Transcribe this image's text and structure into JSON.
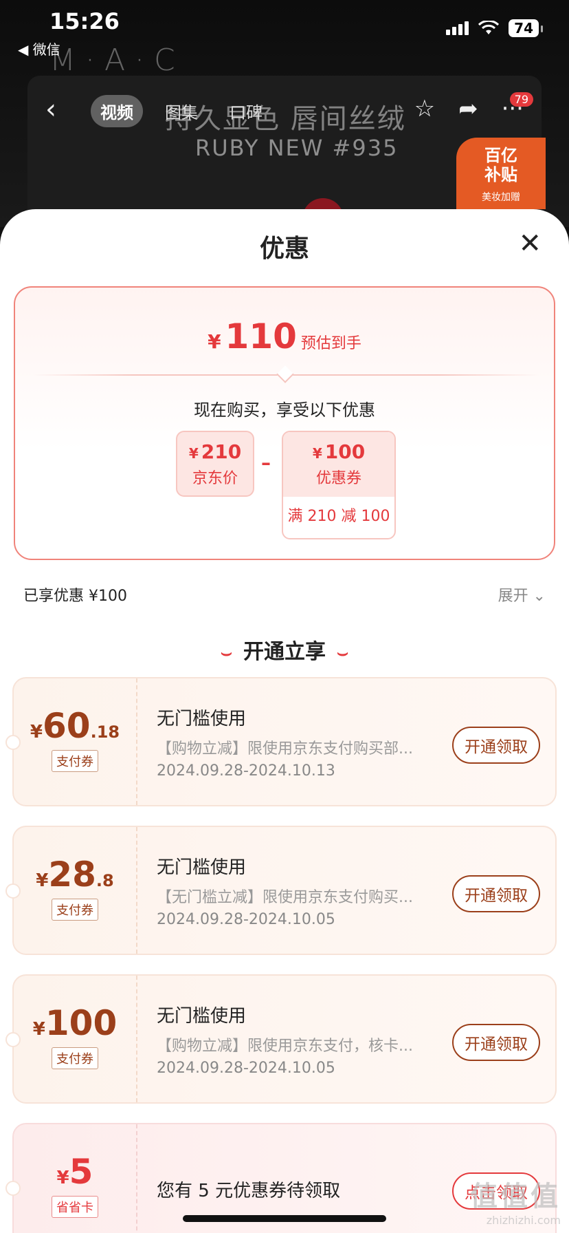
{
  "status": {
    "time": "15:26",
    "back_app": "◀ 微信",
    "battery": "74"
  },
  "backdrop": {
    "logo": "M·A·C",
    "title": "持久显色 唇间丝绒",
    "subtitle": "RUBY NEW #935"
  },
  "nav": {
    "back": "‹",
    "tabs": [
      {
        "label": "视频"
      },
      {
        "label": "图集"
      },
      {
        "label": "口碑"
      }
    ],
    "star": "☆",
    "share": "➦",
    "more": "···",
    "badge": "79"
  },
  "promo_badge": {
    "line1": "百亿",
    "line2": "补贴",
    "line3": "美妆加赠"
  },
  "sheet": {
    "title": "优惠",
    "close": "✕",
    "estimate": {
      "currency": "¥",
      "amount": "110",
      "label": "预估到手"
    },
    "buy_now": "现在购买，享受以下优惠",
    "jd_price": {
      "currency": "¥",
      "value": "210",
      "label": "京东价"
    },
    "minus": "–",
    "coupon_price": {
      "currency": "¥",
      "value": "100",
      "label": "优惠券",
      "rule": "满 210 减 100"
    },
    "enjoyed": "已享优惠 ¥100",
    "expand": "展开 ⌄",
    "section": {
      "left": "⌣",
      "title": "开通立享",
      "right": "⌣"
    },
    "coupons": [
      {
        "currency": "¥",
        "int": "60",
        "dec": ".18",
        "tag": "支付券",
        "title": "无门槛使用",
        "desc": "【购物立减】限使用京东支付购买部...",
        "date": "2024.09.28-2024.10.13",
        "button": "开通领取"
      },
      {
        "currency": "¥",
        "int": "28",
        "dec": ".8",
        "tag": "支付券",
        "title": "无门槛使用",
        "desc": "【无门槛立减】限使用京东支付购买...",
        "date": "2024.09.28-2024.10.05",
        "button": "开通领取"
      },
      {
        "currency": "¥",
        "int": "100",
        "dec": "",
        "tag": "支付券",
        "title": "无门槛使用",
        "desc": "【购物立减】限使用京东支付，核卡...",
        "date": "2024.09.28-2024.10.05",
        "button": "开通领取"
      },
      {
        "currency": "¥",
        "int": "5",
        "dec": "",
        "tag": "省省卡",
        "title": "您有 5 元优惠券待领取",
        "button": "点击领取"
      }
    ]
  },
  "watermark": {
    "line1": "值值值",
    "line2": "zhizhizhi.com"
  },
  "colors": {
    "accent": "#e4393c",
    "coupon_brown": "#9b3f1a"
  }
}
